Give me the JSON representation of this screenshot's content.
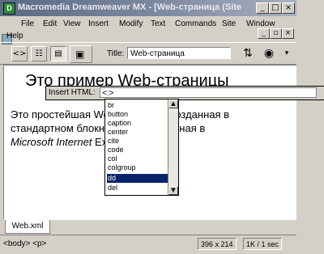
{
  "window": {
    "title": "Macromedia Dreamweaver MX - [Web-страница (Site",
    "app_icon": "dreamweaver-logo-icon"
  },
  "menu": {
    "items": [
      "File",
      "Edit",
      "View",
      "Insert",
      "Modify",
      "Text",
      "Commands",
      "Site",
      "Window",
      "Help"
    ]
  },
  "toolbar": {
    "title_label": "Title:",
    "title_value": "Web-страница",
    "code_view_icon": "<>",
    "split_view_icon": "split-view-icon",
    "design_view_icon": "design-view-icon"
  },
  "document": {
    "heading": "Это пример Web-страницы",
    "para_line1": "Это простейшая Web-страница, созданная в",
    "para_line2": "стандартном блокноте, отображённая в",
    "para_line3_italic": "Microsoft Internet",
    "para_line3_rest": " Explorer."
  },
  "insert_html": {
    "label": "Insert HTML:",
    "value": "<:>",
    "options": [
      "br",
      "button",
      "caption",
      "center",
      "cite",
      "code",
      "col",
      "colgroup",
      "dd",
      "del"
    ],
    "selected_index": 8
  },
  "tab": {
    "label": "Web.xml"
  },
  "status": {
    "tag_selector": "<body> <p>",
    "dimensions": "396 x 214",
    "size_time": "1K / 1 sec"
  }
}
